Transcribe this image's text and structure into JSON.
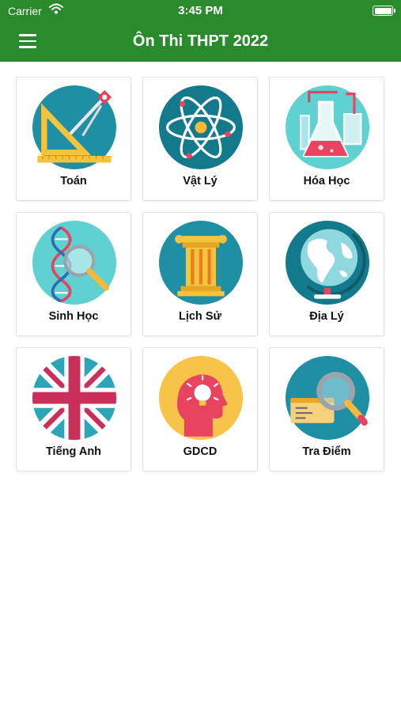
{
  "status_bar": {
    "carrier": "Carrier",
    "time": "3:45 PM",
    "wifi_icon": "wifi-icon",
    "battery_icon": "battery-icon"
  },
  "nav": {
    "title": "Ôn Thi THPT 2022",
    "menu_icon": "hamburger-menu-icon",
    "background": "#2a8a2c"
  },
  "subjects": [
    {
      "label": "Toán",
      "icon": "geometry-tools-icon"
    },
    {
      "label": "Vật Lý",
      "icon": "atom-icon"
    },
    {
      "label": "Hóa Học",
      "icon": "chemistry-flask-icon"
    },
    {
      "label": "Sinh Học",
      "icon": "dna-magnifier-icon"
    },
    {
      "label": "Lịch Sử",
      "icon": "greek-column-icon"
    },
    {
      "label": "Địa Lý",
      "icon": "globe-icon"
    },
    {
      "label": "Tiếng Anh",
      "icon": "uk-flag-icon"
    },
    {
      "label": "GDCD",
      "icon": "head-lightbulb-icon"
    },
    {
      "label": "Tra Điểm",
      "icon": "search-score-icon"
    }
  ]
}
